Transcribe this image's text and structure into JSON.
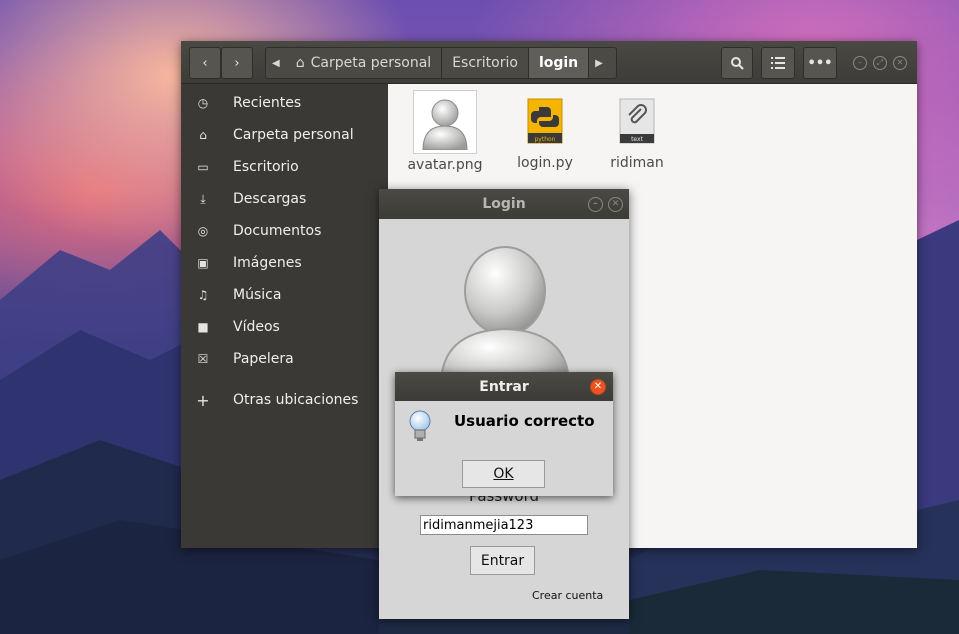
{
  "files_window": {
    "breadcrumbs": [
      {
        "label": "Carpeta personal"
      },
      {
        "label": "Escritorio"
      },
      {
        "label": "login"
      }
    ],
    "sidebar": {
      "items": [
        {
          "label": "Recientes",
          "icon": "clock-icon"
        },
        {
          "label": "Carpeta personal",
          "icon": "home-icon"
        },
        {
          "label": "Escritorio",
          "icon": "desktop-icon"
        },
        {
          "label": "Descargas",
          "icon": "download-icon"
        },
        {
          "label": "Documentos",
          "icon": "document-icon"
        },
        {
          "label": "Imágenes",
          "icon": "image-icon"
        },
        {
          "label": "Música",
          "icon": "music-icon"
        },
        {
          "label": "Vídeos",
          "icon": "video-icon"
        },
        {
          "label": "Papelera",
          "icon": "trash-icon"
        },
        {
          "label": "Otras ubicaciones",
          "icon": "plus-icon"
        }
      ]
    },
    "files": [
      {
        "name": "avatar.png",
        "type": "image"
      },
      {
        "name": "login.py",
        "type": "python",
        "badge": "python"
      },
      {
        "name": "ridiman",
        "type": "text",
        "badge": "text"
      }
    ]
  },
  "login_window": {
    "title": "Login",
    "password_label": "Password",
    "password_value": "ridimanmejia123",
    "submit_label": "Entrar",
    "create_account_label": "Crear cuenta"
  },
  "dialog": {
    "title": "Entrar",
    "message": "Usuario correcto",
    "ok_label": "OK"
  },
  "colors": {
    "accent_close": "#e95420",
    "headerbar": "#3d3c38",
    "sidebar": "#3a3935"
  }
}
